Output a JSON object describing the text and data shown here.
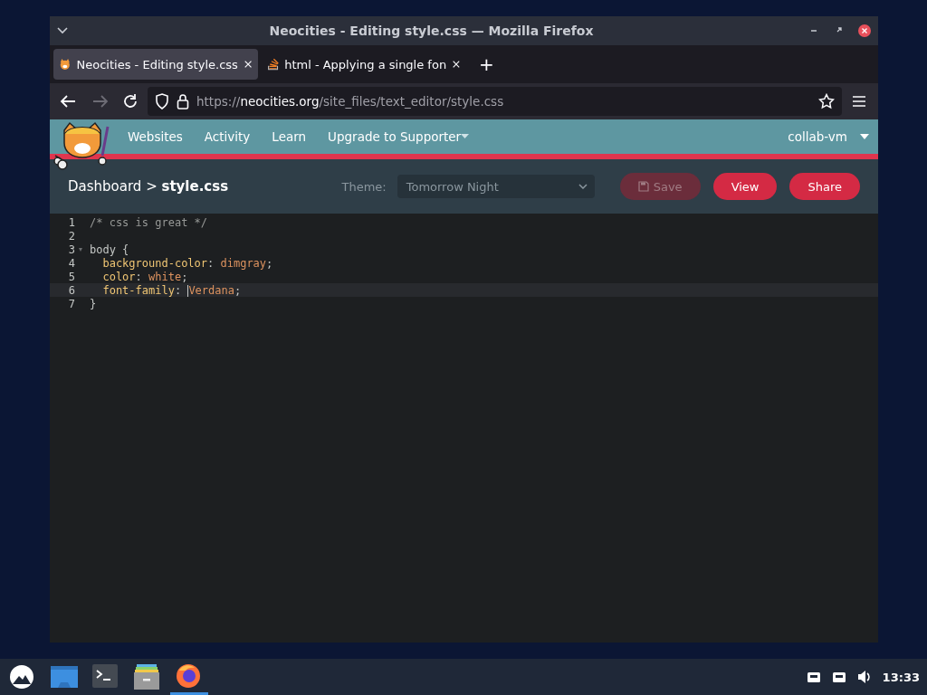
{
  "window": {
    "title": "Neocities - Editing style.css — Mozilla Firefox"
  },
  "tabs": [
    {
      "label": "Neocities - Editing style.css",
      "selected": true
    },
    {
      "label": "html - Applying a single fon",
      "selected": false
    }
  ],
  "new_tab": "+",
  "address_bar": {
    "prefix": "https://",
    "domain": "neocities.org",
    "path": "/site_files/text_editor/style.css"
  },
  "site_nav": {
    "items": [
      "Websites",
      "Activity",
      "Learn",
      "Upgrade to Supporter"
    ],
    "user": "collab-vm"
  },
  "editor_bar": {
    "breadcrumb_root": "Dashboard >",
    "file": "style.css",
    "theme_label": "Theme:",
    "theme": "Tomorrow Night",
    "buttons": [
      {
        "label": "Save",
        "disabled": true
      },
      {
        "label": "View",
        "disabled": false
      },
      {
        "label": "Share",
        "disabled": false
      }
    ]
  },
  "code": [
    {
      "number": "1",
      "foldable": false,
      "cursor": false,
      "tokens": [
        {
          "text": "/* css is great */",
          "kind": "comment"
        }
      ]
    },
    {
      "number": "2",
      "foldable": false,
      "cursor": false
    },
    {
      "number": "3",
      "foldable": true,
      "cursor": false,
      "tokens": [
        {
          "text": "body {",
          "kind": "plain"
        }
      ]
    },
    {
      "number": "4",
      "foldable": false,
      "cursor": false,
      "tokens": [
        {
          "text": "  background-color",
          "kind": "property"
        },
        {
          "text": ": ",
          "kind": "plain"
        },
        {
          "text": "dimgray",
          "kind": "value"
        },
        {
          "text": ";",
          "kind": "plain"
        }
      ]
    },
    {
      "number": "5",
      "foldable": false,
      "cursor": false,
      "tokens": [
        {
          "text": "  color",
          "kind": "property"
        },
        {
          "text": ": ",
          "kind": "plain"
        },
        {
          "text": "white",
          "kind": "value"
        },
        {
          "text": ";",
          "kind": "plain"
        }
      ]
    },
    {
      "number": "6",
      "foldable": false,
      "cursor": true,
      "tokens": [
        {
          "text": "  font-family",
          "kind": "property"
        },
        {
          "text": ": ",
          "kind": "plain"
        },
        {
          "text": "Verdana",
          "kind": "value"
        },
        {
          "text": ";",
          "kind": "plain"
        }
      ]
    },
    {
      "number": "7",
      "foldable": false,
      "cursor": false,
      "tokens": [
        {
          "text": "}",
          "kind": "plain"
        }
      ]
    }
  ],
  "taskbar": {
    "apps": [
      {
        "kind": "launcher",
        "active": false
      },
      {
        "kind": "desktop",
        "active": false
      },
      {
        "kind": "terminal",
        "active": false
      },
      {
        "kind": "files",
        "active": false
      },
      {
        "kind": "firefox",
        "active": true
      }
    ],
    "clock": "13:33"
  }
}
